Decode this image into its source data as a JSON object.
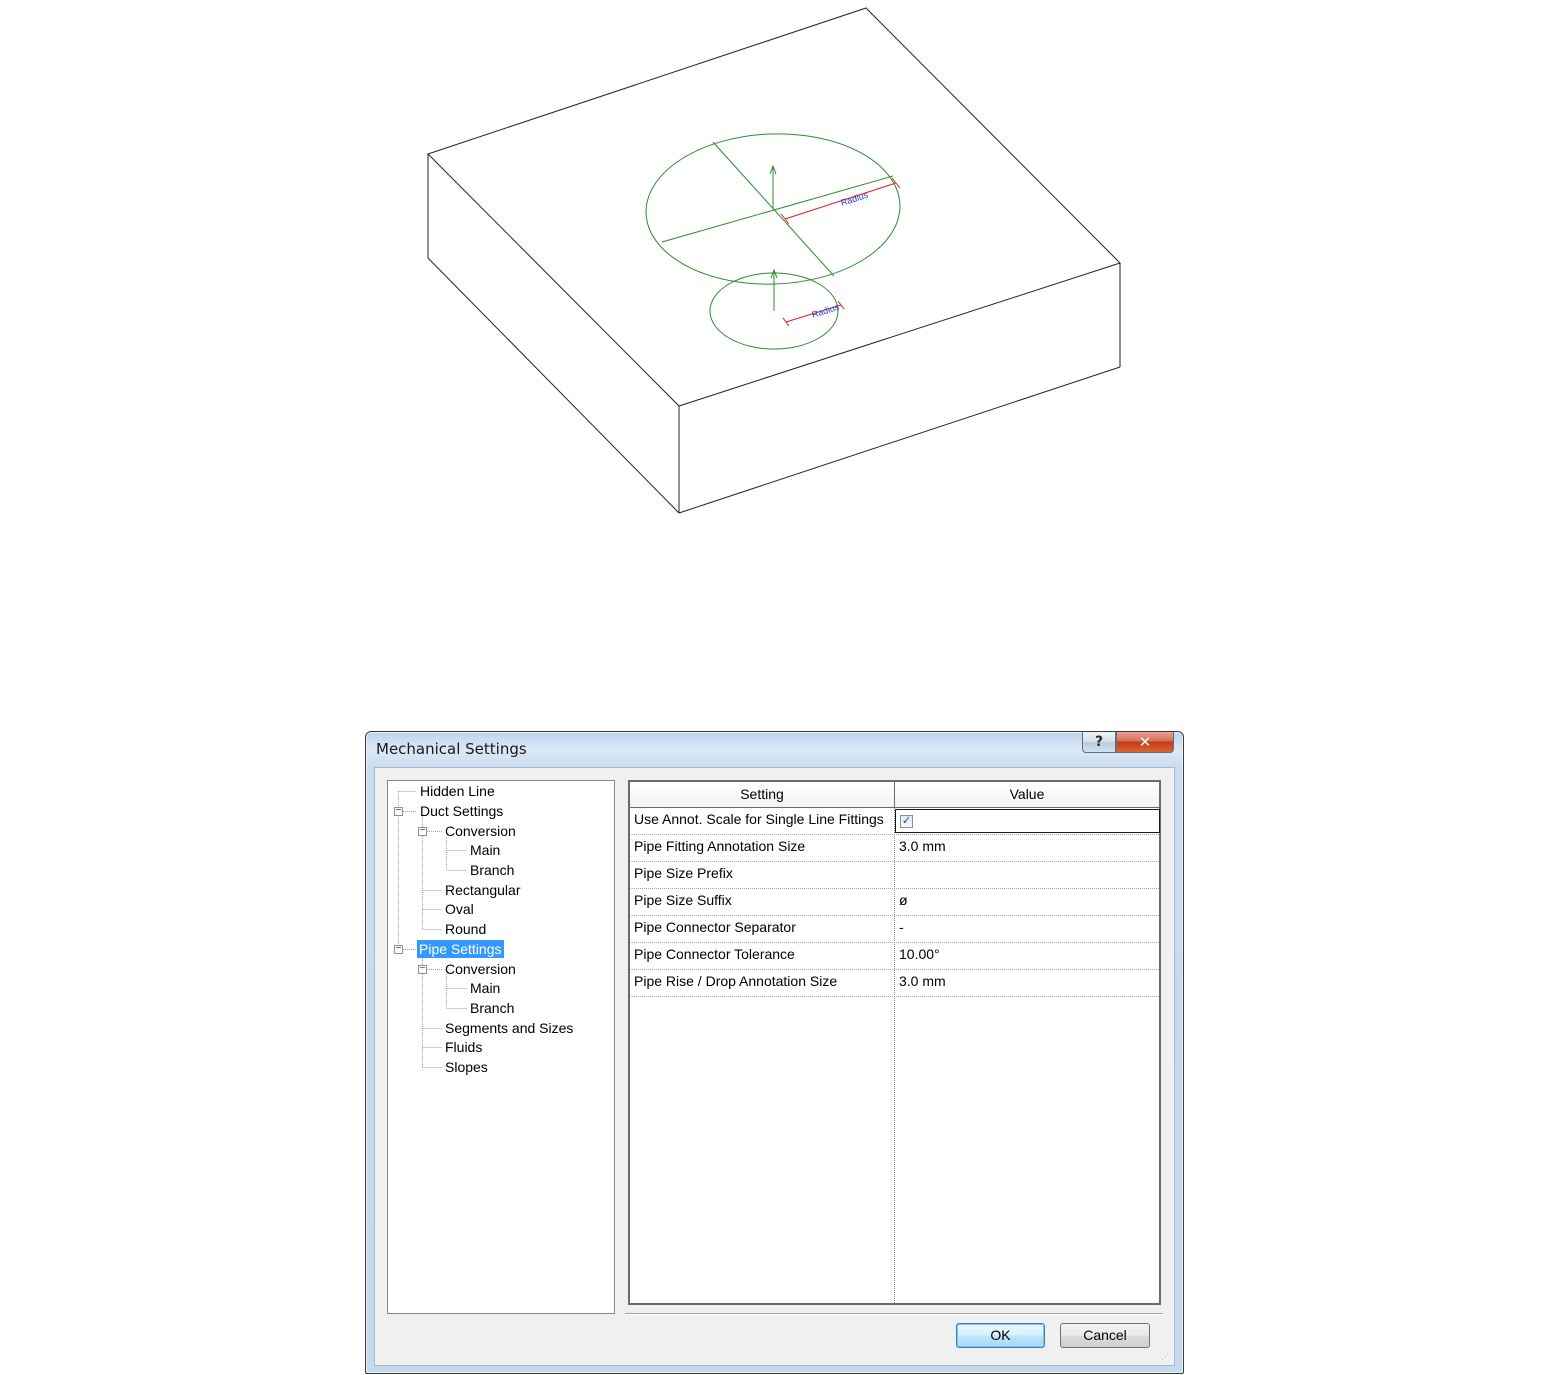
{
  "sketch": {
    "large_radius_label": "Radius",
    "small_radius_label": "Radius",
    "colors": {
      "edges": "#222222",
      "circles": "#2e8b2e",
      "radius_dimension": "#e02020",
      "label": "#2040c8"
    }
  },
  "dialog": {
    "title": "Mechanical Settings",
    "help_icon": "question-mark-icon",
    "help_label": "?",
    "close_icon": "close-icon",
    "close_label": "✕",
    "tree": {
      "items": [
        {
          "label": "Hidden Line",
          "level": 0
        },
        {
          "label": "Duct Settings",
          "level": 0,
          "expanded": true
        },
        {
          "label": "Conversion",
          "level": 1,
          "expanded": true
        },
        {
          "label": "Main",
          "level": 2
        },
        {
          "label": "Branch",
          "level": 2
        },
        {
          "label": "Rectangular",
          "level": 1
        },
        {
          "label": "Oval",
          "level": 1
        },
        {
          "label": "Round",
          "level": 1
        },
        {
          "label": "Pipe Settings",
          "level": 0,
          "expanded": true,
          "selected": true
        },
        {
          "label": "Conversion",
          "level": 1,
          "expanded": true
        },
        {
          "label": "Main",
          "level": 2
        },
        {
          "label": "Branch",
          "level": 2
        },
        {
          "label": "Segments and Sizes",
          "level": 1
        },
        {
          "label": "Fluids",
          "level": 1
        },
        {
          "label": "Slopes",
          "level": 1
        }
      ]
    },
    "grid": {
      "headers": {
        "setting": "Setting",
        "value": "Value"
      },
      "rows": [
        {
          "setting": "Use Annot. Scale for Single Line Fittings",
          "value": "",
          "checked": true
        },
        {
          "setting": "Pipe Fitting Annotation Size",
          "value": "3.0 mm"
        },
        {
          "setting": "Pipe Size Prefix",
          "value": ""
        },
        {
          "setting": "Pipe Size Suffix",
          "value": "ø"
        },
        {
          "setting": "Pipe Connector Separator",
          "value": "-"
        },
        {
          "setting": "Pipe Connector Tolerance",
          "value": "10.00°"
        },
        {
          "setting": "Pipe Rise / Drop Annotation Size",
          "value": "3.0 mm"
        }
      ]
    },
    "buttons": {
      "ok": "OK",
      "cancel": "Cancel"
    }
  }
}
